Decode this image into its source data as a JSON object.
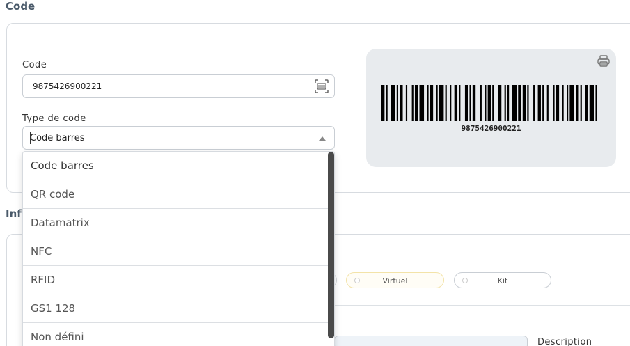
{
  "sections": {
    "code_title": "Code",
    "info_title_partial": "Info"
  },
  "code_field": {
    "label": "Code",
    "value": "9875426900221"
  },
  "type_field": {
    "label": "Type de code",
    "value": "Code barres"
  },
  "barcode_preview": {
    "number": "9875426900221"
  },
  "dropdown": {
    "options": [
      "Code barres",
      "QR code",
      "Datamatrix",
      "NFC",
      "RFID",
      "GS1 128",
      "Non défini"
    ]
  },
  "toggles": {
    "virtuel": "Virtuel",
    "kit": "Kit"
  },
  "description_label": "Description",
  "icons": {
    "scan": "barcode-scan-icon",
    "print": "printer-icon",
    "dropdown_arrow": "caret-up-icon"
  }
}
